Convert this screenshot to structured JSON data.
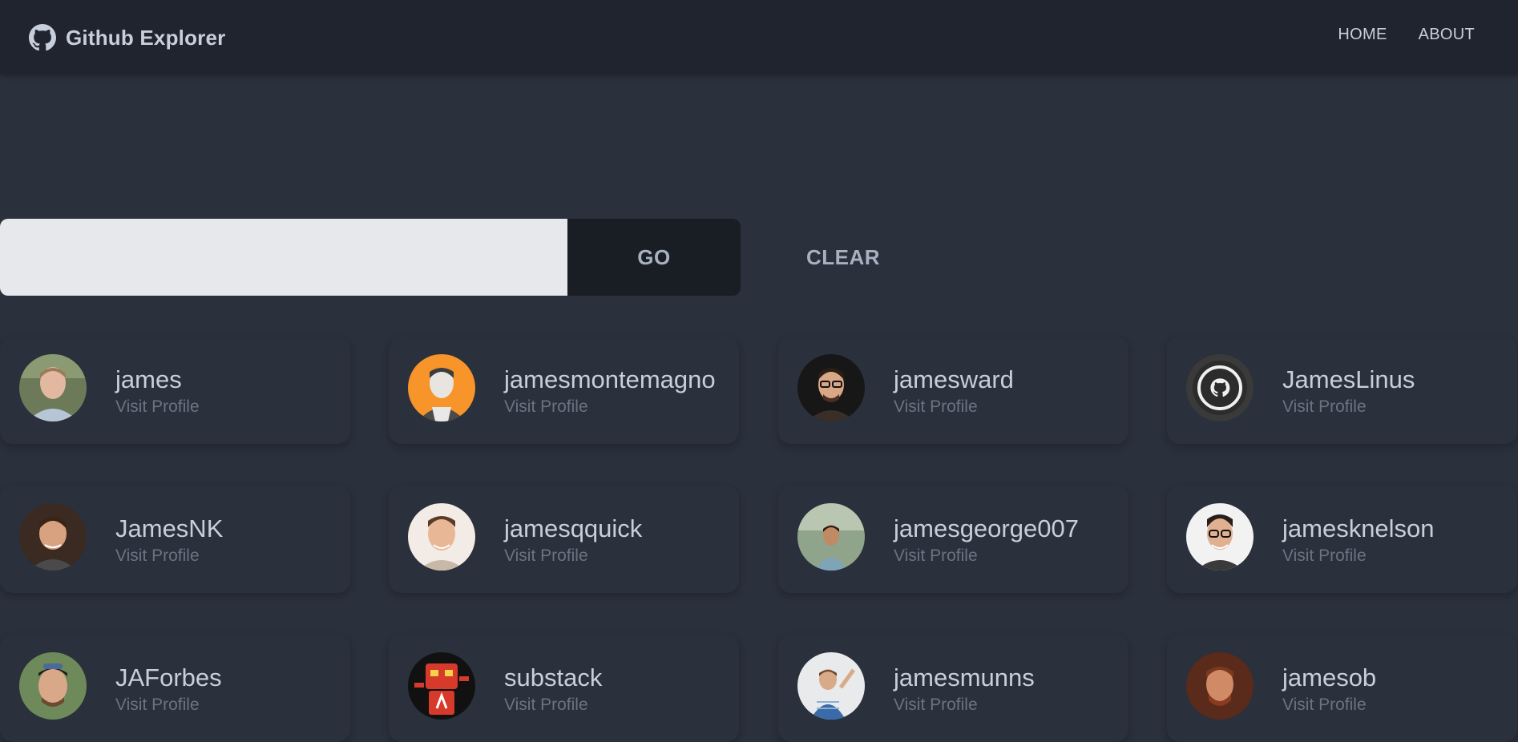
{
  "navbar": {
    "brand": "Github Explorer",
    "links": [
      "HOME",
      "ABOUT"
    ]
  },
  "search": {
    "value": "",
    "placeholder": "",
    "go_label": "GO",
    "clear_label": "CLEAR"
  },
  "users": [
    {
      "name": "james",
      "link": "Visit Profile"
    },
    {
      "name": "jamesmontemagno",
      "link": "Visit Profile"
    },
    {
      "name": "jamesward",
      "link": "Visit Profile"
    },
    {
      "name": "JamesLinus",
      "link": "Visit Profile"
    },
    {
      "name": "JamesNK",
      "link": "Visit Profile"
    },
    {
      "name": "jamesqquick",
      "link": "Visit Profile"
    },
    {
      "name": "jamesgeorge007",
      "link": "Visit Profile"
    },
    {
      "name": "jamesknelson",
      "link": "Visit Profile"
    },
    {
      "name": "JAForbes",
      "link": "Visit Profile"
    },
    {
      "name": "substack",
      "link": "Visit Profile"
    },
    {
      "name": "jamesmunns",
      "link": "Visit Profile"
    },
    {
      "name": "jamesob",
      "link": "Visit Profile"
    }
  ],
  "colors": {
    "background": "#2a303c",
    "navbar": "#1f242e",
    "text": "#c7cfdc",
    "muted": "#6b7382",
    "input": "#e6e8ec",
    "button": "#191d24"
  }
}
